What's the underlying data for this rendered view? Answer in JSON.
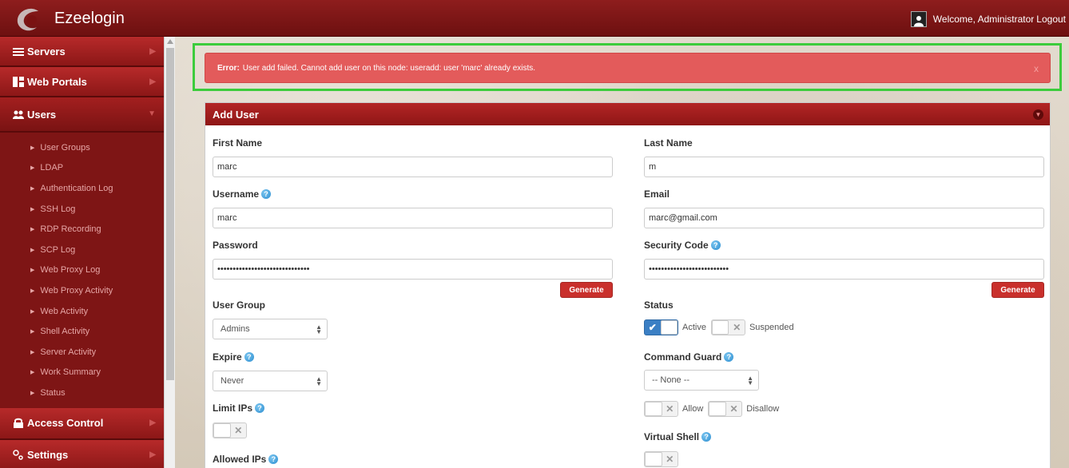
{
  "topbar": {
    "brand": "Ezeelogin",
    "welcome": "Welcome, Administrator",
    "logout": "Logout"
  },
  "sidebar": {
    "items": [
      {
        "label": "Servers",
        "icon": "list-icon"
      },
      {
        "label": "Web Portals",
        "icon": "portal-icon"
      },
      {
        "label": "Users",
        "icon": "users-icon"
      }
    ],
    "sub_items": [
      "User Groups",
      "LDAP",
      "Authentication Log",
      "SSH Log",
      "RDP Recording",
      "SCP Log",
      "Web Proxy Log",
      "Web Proxy Activity",
      "Web Activity",
      "Shell Activity",
      "Server Activity",
      "Work Summary",
      "Status"
    ],
    "bottom_items": [
      {
        "label": "Access Control",
        "icon": "lock-icon"
      },
      {
        "label": "Settings",
        "icon": "gear-icon"
      }
    ]
  },
  "alert": {
    "prefix": "Error:",
    "message": "User add failed. Cannot add user on this node: useradd: user 'marc' already exists.",
    "close": "x"
  },
  "panel": {
    "title": "Add User",
    "first_name": {
      "label": "First Name",
      "value": "marc"
    },
    "last_name": {
      "label": "Last Name",
      "value": "m"
    },
    "username": {
      "label": "Username",
      "value": "marc"
    },
    "email": {
      "label": "Email",
      "value": "marc@gmail.com"
    },
    "password": {
      "label": "Password",
      "value": "••••••••••••••••••••••••••••••"
    },
    "security_code": {
      "label": "Security Code",
      "value": "••••••••••••••••••••••••••"
    },
    "generate": "Generate",
    "user_group": {
      "label": "User Group",
      "value": "Admins"
    },
    "status": {
      "label": "Status",
      "active": "Active",
      "suspended": "Suspended"
    },
    "expire": {
      "label": "Expire",
      "value": "Never"
    },
    "command_guard": {
      "label": "Command Guard",
      "value": "-- None --",
      "allow": "Allow",
      "disallow": "Disallow"
    },
    "limit_ips": {
      "label": "Limit IPs"
    },
    "virtual_shell": {
      "label": "Virtual Shell"
    },
    "allowed_ips": {
      "label": "Allowed IPs"
    }
  }
}
